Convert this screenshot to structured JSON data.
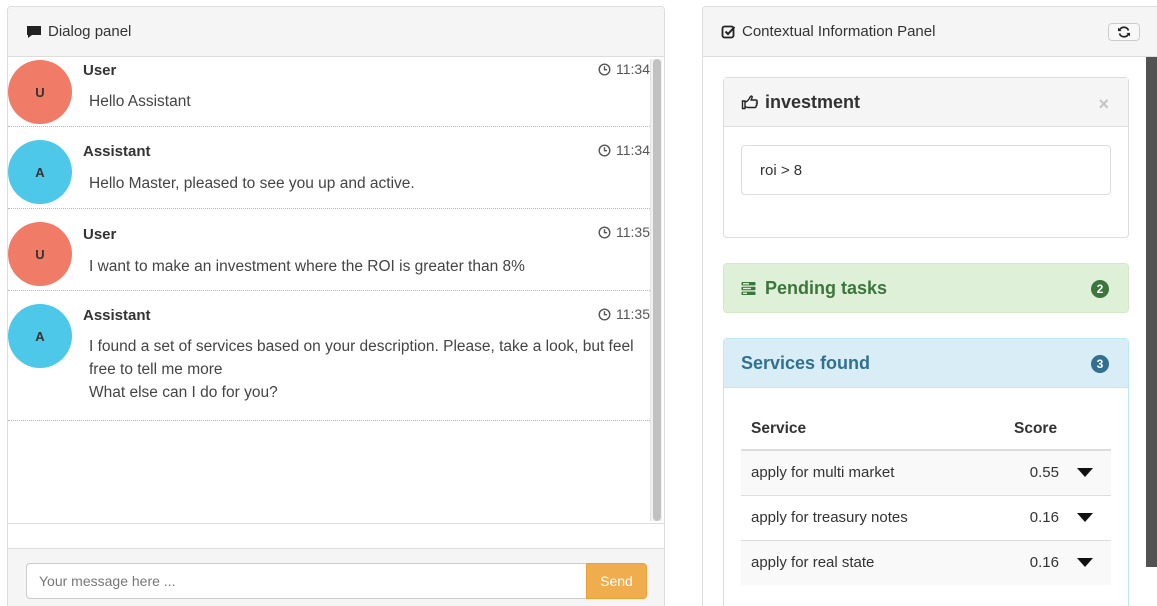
{
  "dialog": {
    "title": "Dialog panel",
    "messages": [
      {
        "author": "User",
        "initial": "U",
        "time": "11:34",
        "text": "Hello Assistant"
      },
      {
        "author": "Assistant",
        "initial": "A",
        "time": "11:34",
        "text": "Hello Master, pleased to see you up and active."
      },
      {
        "author": "User",
        "initial": "U",
        "time": "11:35",
        "text": "I want to make an investment where the ROI is greater than 8%"
      },
      {
        "author": "Assistant",
        "initial": "A",
        "time": "11:35",
        "text": "I found a set of services based on your description. Please, take a look, but feel free to tell me more",
        "text2": "What else can I do for you?"
      }
    ],
    "input": {
      "placeholder": "Your message here ...",
      "value": ""
    },
    "send_label": "Send"
  },
  "context": {
    "title": "Contextual Information Panel",
    "investment": {
      "title": "investment",
      "close": "×",
      "query": "roi > 8"
    },
    "pending": {
      "title": "Pending tasks",
      "count": "2"
    },
    "services": {
      "title": "Services found",
      "count": "3",
      "columns": [
        "Service",
        "Score"
      ],
      "rows": [
        {
          "service": "apply for multi market",
          "score": "0.55"
        },
        {
          "service": "apply for treasury notes",
          "score": "0.16"
        },
        {
          "service": "apply for real state",
          "score": "0.16"
        }
      ]
    }
  },
  "colors": {
    "user_avatar": "#f07b66",
    "assistant_avatar": "#4dc8e8",
    "send_button": "#f0ad4e",
    "pending_bg": "#dff0d8",
    "services_bg": "#d9edf7"
  },
  "icons": {
    "dialog": "comment-icon",
    "context": "check-square-icon",
    "refresh": "refresh-icon",
    "clock": "clock-icon",
    "investment": "hand-pointing-icon",
    "pending": "tasks-icon",
    "row_toggle": "caret-down-icon"
  }
}
